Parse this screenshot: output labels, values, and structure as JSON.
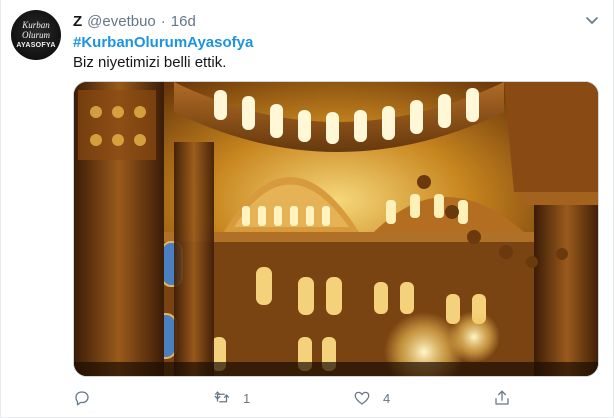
{
  "tweet": {
    "avatar": {
      "line1": "Kurban",
      "line2": "Olurum",
      "line3": "AYASOFYA"
    },
    "display_name": "Z",
    "handle": "@evetbuo",
    "separator": "·",
    "time": "16d",
    "hashtag": "#KurbanOlurumAyasofya",
    "text": "Biz niyetimizi belli ettik.",
    "media_icon": "mosque-interior-photo",
    "actions": {
      "reply_count": "",
      "retweet_count": "1",
      "like_count": "4"
    },
    "colors": {
      "link": "#1b95e0",
      "secondary": "#657786",
      "text": "#14171a"
    }
  }
}
